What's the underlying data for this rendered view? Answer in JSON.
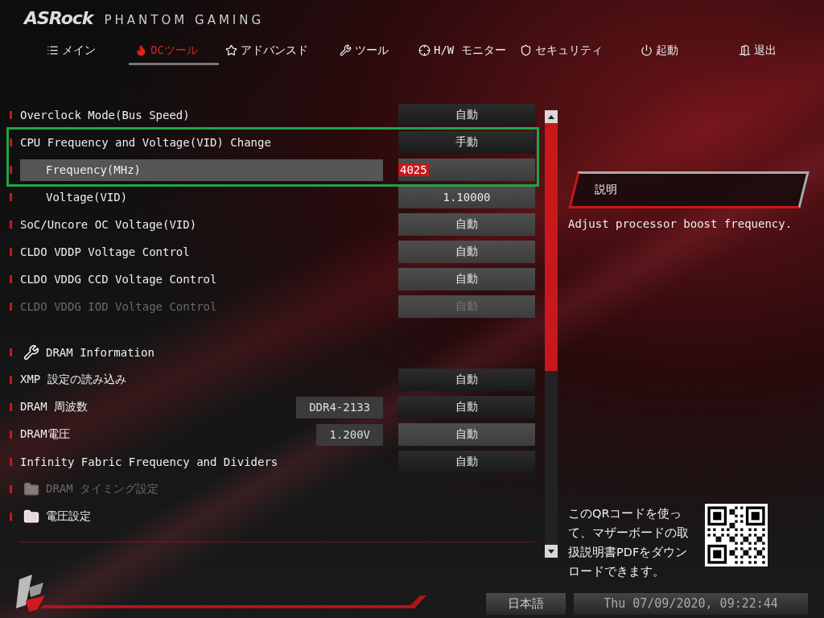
{
  "header": {
    "brand": "ASRock",
    "product": "PHANTOM GAMING"
  },
  "tabs": [
    {
      "label": "メイン",
      "selected": false
    },
    {
      "label": "OCツール",
      "selected": true
    },
    {
      "label": "アドバンスド",
      "selected": false
    },
    {
      "label": "ツール",
      "selected": false
    },
    {
      "label": "H/W モニター",
      "selected": false
    },
    {
      "label": "セキュリティ",
      "selected": false
    },
    {
      "label": "起動",
      "selected": false
    },
    {
      "label": "退出",
      "selected": false
    }
  ],
  "settings": [
    {
      "kind": "option",
      "label": "Overclock Mode(Bus Speed)",
      "value": "自動",
      "selected": false,
      "disabled": false
    },
    {
      "kind": "option",
      "label": "CPU Frequency and Voltage(VID) Change",
      "value": "手動",
      "selected": false,
      "disabled": false,
      "children": [
        {
          "kind": "field",
          "label": "Frequency(MHz)",
          "value": "4025",
          "selected": true,
          "disabled": false,
          "editing": true
        },
        {
          "kind": "field",
          "label": "Voltage(VID)",
          "value": "1.10000",
          "selected": false,
          "disabled": false,
          "editing": false
        }
      ]
    },
    {
      "kind": "field",
      "label": "SoC/Uncore OC Voltage(VID)",
      "value": "自動",
      "selected": false,
      "disabled": false,
      "editing": false
    },
    {
      "kind": "field",
      "label": "CLDO VDDP Voltage Control",
      "value": "自動",
      "selected": false,
      "disabled": false,
      "editing": false
    },
    {
      "kind": "field",
      "label": "CLDO VDDG CCD Voltage Control",
      "value": "自動",
      "selected": false,
      "disabled": false,
      "editing": false
    },
    {
      "kind": "field",
      "label": "CLDO VDDG IOD Voltage Control",
      "value": "自動",
      "selected": false,
      "disabled": true,
      "editing": false
    },
    {
      "kind": "section",
      "label": "DRAM Information",
      "selected": false,
      "disabled": false
    },
    {
      "kind": "option",
      "label": "XMP 設定の読み込み",
      "value": "自動",
      "selected": false,
      "disabled": false
    },
    {
      "kind": "option",
      "label": "DRAM 周波数",
      "info": "DDR4-2133",
      "value": "自動",
      "selected": false,
      "disabled": false
    },
    {
      "kind": "field",
      "label": "DRAM電圧",
      "info": "1.200V",
      "value": "自動",
      "selected": false,
      "disabled": false,
      "editing": false
    },
    {
      "kind": "option",
      "label": "Infinity Fabric Frequency and Dividers",
      "value": "自動",
      "selected": false,
      "disabled": false
    },
    {
      "kind": "folder",
      "label": "DRAM タイミング設定",
      "selected": false,
      "disabled": true
    },
    {
      "kind": "folder",
      "label": "電圧設定",
      "selected": false,
      "disabled": false
    }
  ],
  "help": {
    "title": "説明",
    "text": "Adjust processor boost frequency."
  },
  "qr": {
    "text": "このQRコードを使って、マザーボードの取扱説明書PDFをダウンロードできます。"
  },
  "footer": {
    "language": "日本語",
    "datetime": "Thu 07/09/2020, 09:22:44"
  }
}
